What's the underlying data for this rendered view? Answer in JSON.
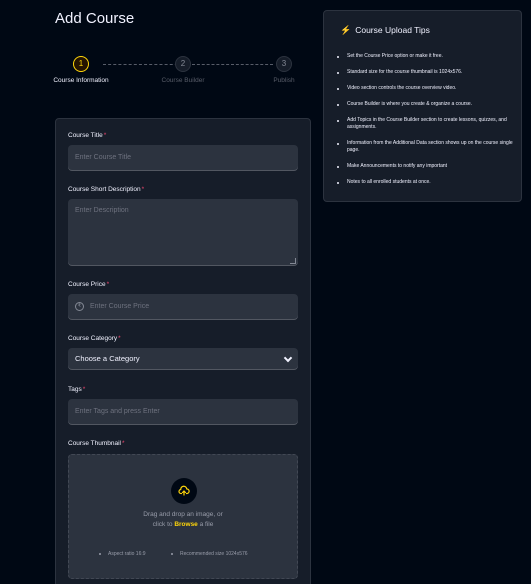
{
  "page": {
    "title": "Add Course"
  },
  "stepper": {
    "steps": [
      {
        "number": "1",
        "label": "Course Information",
        "state": "active"
      },
      {
        "number": "2",
        "label": "Course Builder",
        "state": "upcoming"
      },
      {
        "number": "3",
        "label": "Publish",
        "state": "upcoming"
      }
    ]
  },
  "form": {
    "title": {
      "label": "Course Title",
      "required_mark": "*",
      "placeholder": "Enter Course Title"
    },
    "short_description": {
      "label": "Course Short Description",
      "required_mark": "*",
      "placeholder": "Enter Description"
    },
    "price": {
      "label": "Course Price",
      "required_mark": "*",
      "placeholder": "Enter Course Price",
      "currency_icon": "₹"
    },
    "category": {
      "label": "Course Category",
      "required_mark": "*",
      "selected": "Choose a Category"
    },
    "tags": {
      "label": "Tags",
      "required_mark": "*",
      "placeholder": "Enter Tags and press Enter"
    },
    "thumbnail": {
      "label": "Course Thumbnail",
      "required_mark": "*",
      "drop_text_line1": "Drag and drop an image, or",
      "drop_text_prefix": "click to ",
      "browse_label": "Browse",
      "drop_text_suffix": " a file",
      "aspect_note": "Aspect ratio 16:9",
      "size_note": "Recommended size 1024x576"
    }
  },
  "tips": {
    "title": "Course Upload Tips",
    "icon": "lightning-icon",
    "items": [
      "Set the Course Price option or make it free.",
      "Standard size for the course thumbnail is 1024x576.",
      "Video section controls the course overview video.",
      "Course Builder is where you create & organize a course.",
      "Add Topics in the Course Builder section to create lessons, quizzes, and assignments.",
      "Information from the Additional Data section shows up on the course single page.",
      "Make Announcements to notify any important",
      "Notes to all enrolled students at once."
    ]
  },
  "colors": {
    "accent": "#ffd60a",
    "background": "#000814",
    "card": "#161d29",
    "input": "#2c333f",
    "required": "#ef476f",
    "tip_icon": "#f9a826"
  }
}
